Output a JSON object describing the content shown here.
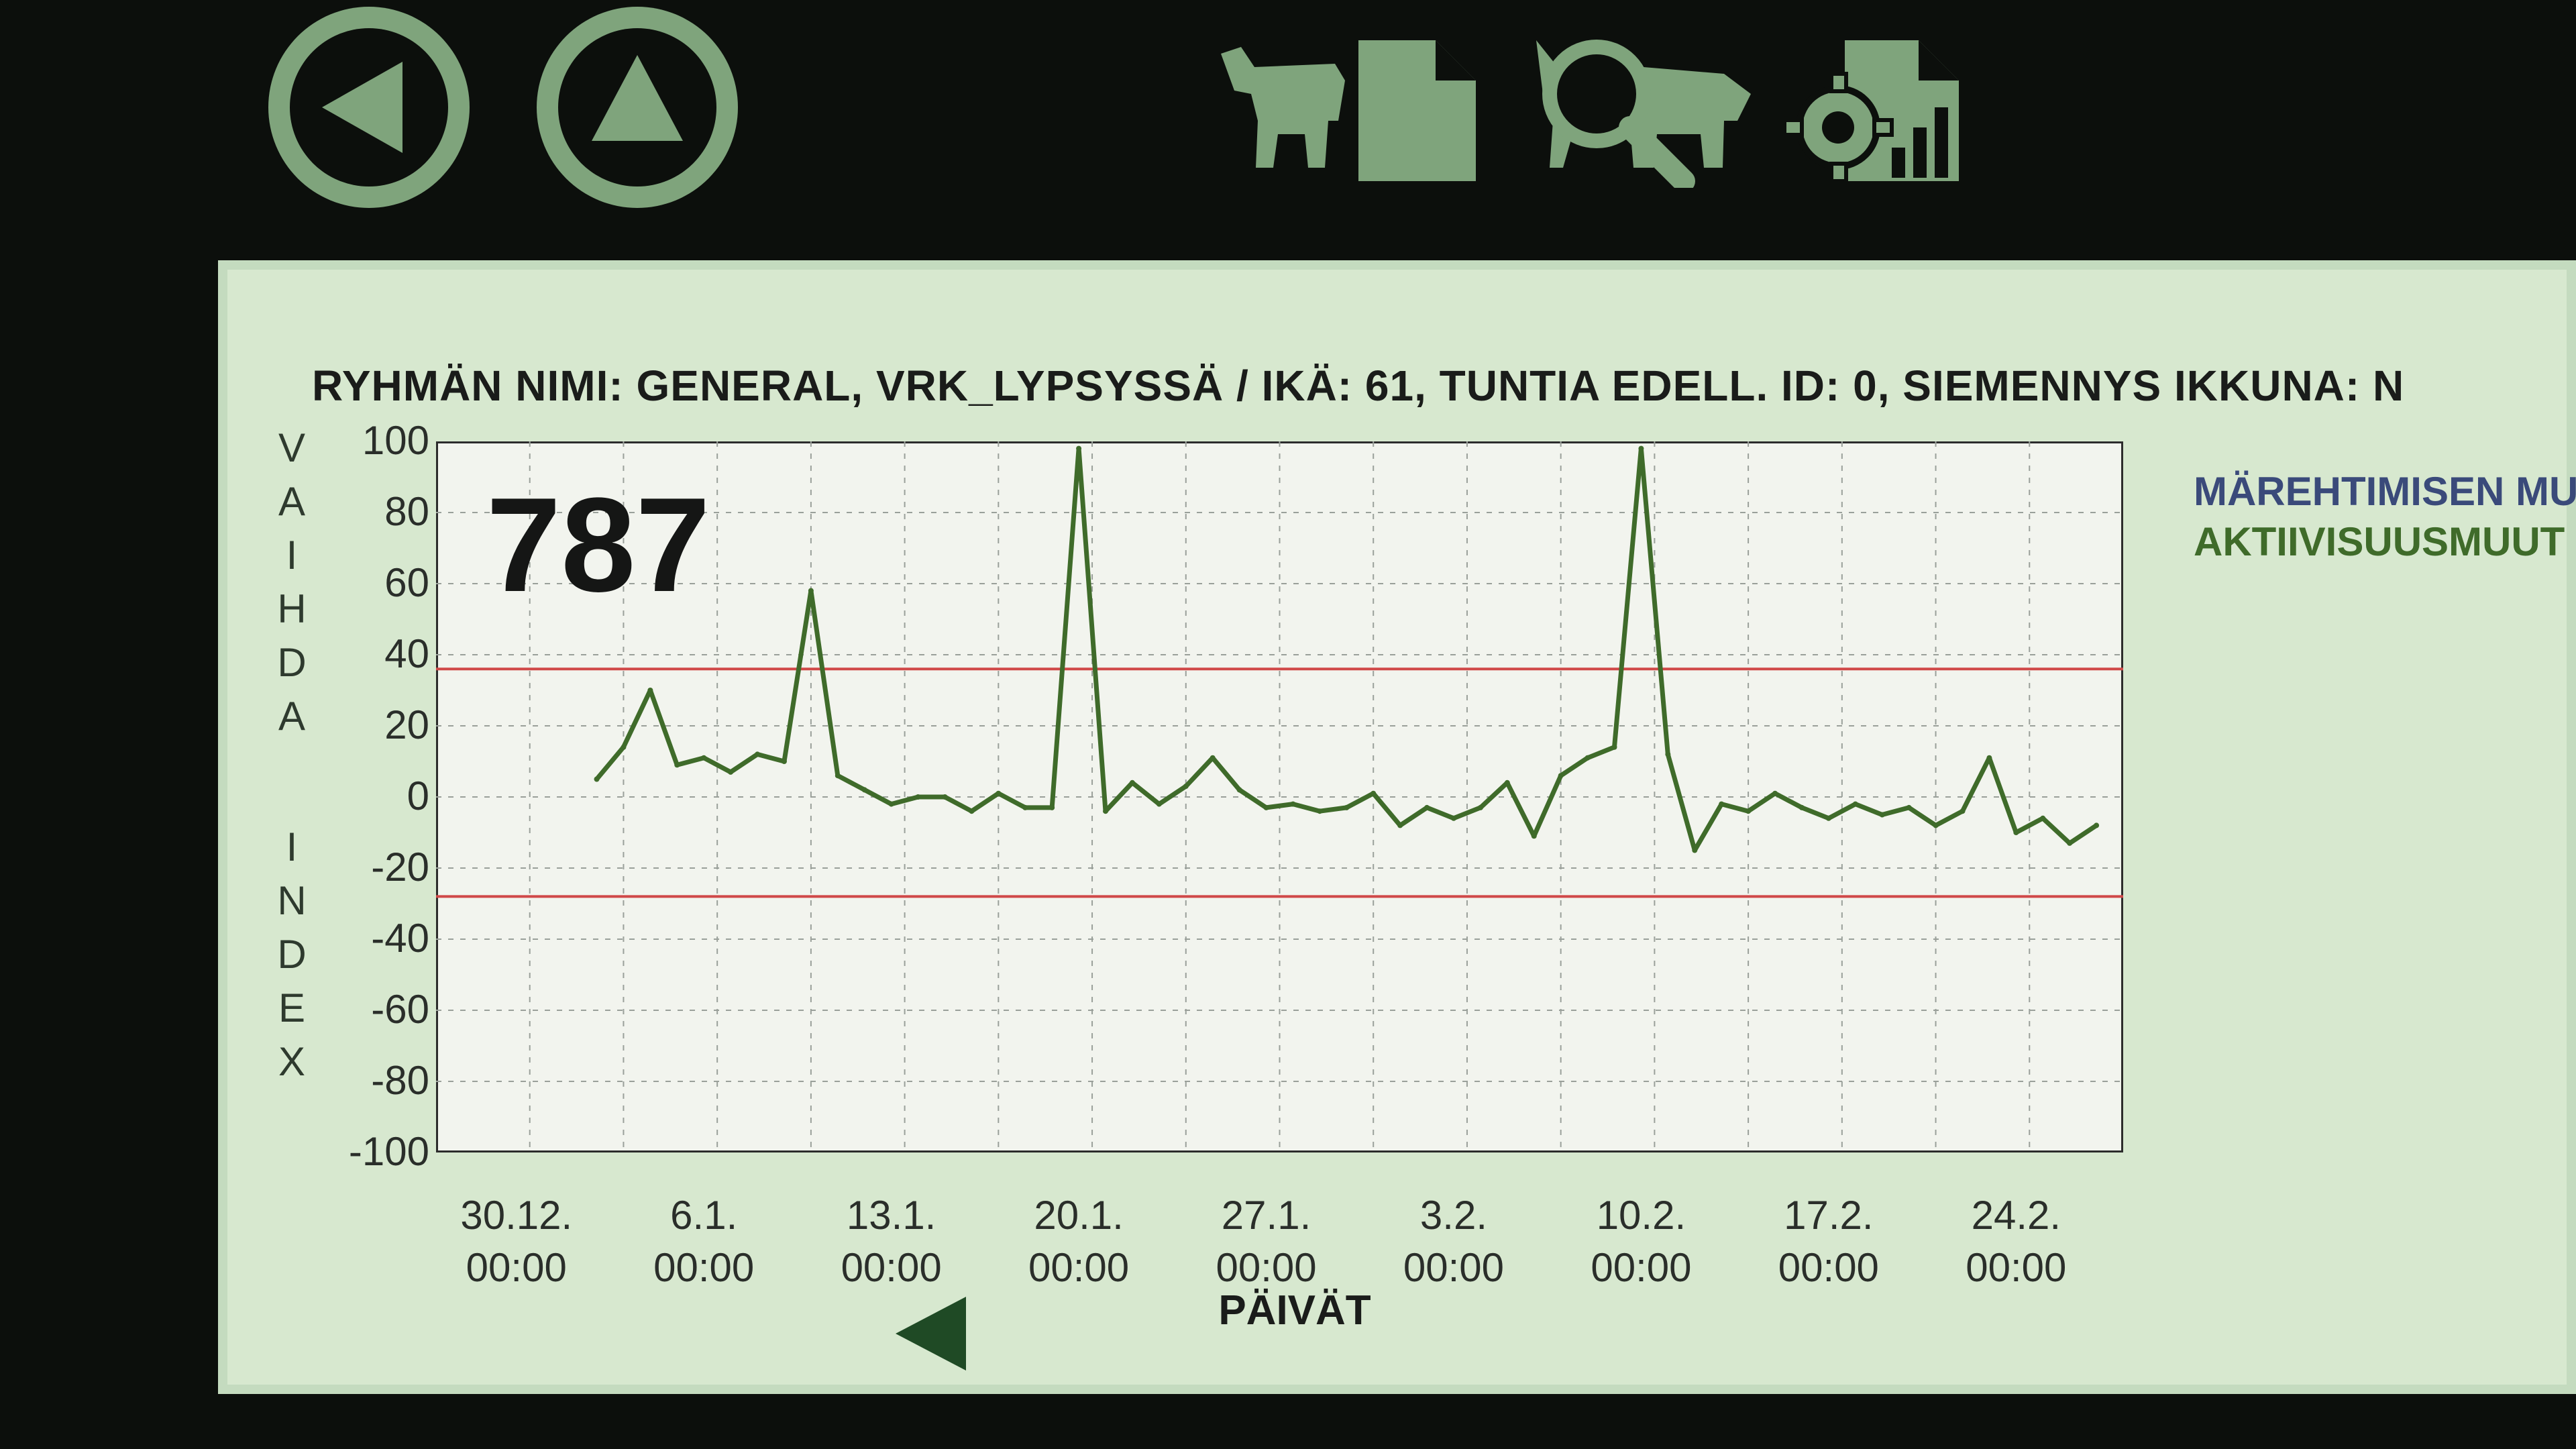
{
  "toolbar": {
    "icons": [
      "back-arrow-icon",
      "up-arrow-icon",
      "cow-report-icon",
      "search-cow-icon",
      "settings-chart-icon"
    ]
  },
  "header": {
    "text": "RYHMÄN NIMI: GENERAL, VRK_LYPSYSSÄ / IKÄ: 61, TUNTIA EDELL. ID: 0, SIEMENNYS IKKUNA: N"
  },
  "cow": {
    "id": "787"
  },
  "legend": {
    "items": [
      {
        "label": "MÄREHTIMISEN MU",
        "color": "#3a4a7a"
      },
      {
        "label": "AKTIIVISUUSMUUT",
        "color": "#3f6b2a"
      }
    ]
  },
  "nav": {
    "prev_symbol": "◀"
  },
  "chart_data": {
    "type": "line",
    "ylabel": "VAIHDA INDEX",
    "xlabel": "PÄIVÄT",
    "ylim": [
      -100,
      100
    ],
    "yticks": [
      "100",
      "80",
      "60",
      "40",
      "20",
      "0",
      "-20",
      "-40",
      "-60",
      "-80",
      "-100"
    ],
    "xticks": [
      {
        "date": "30.12.",
        "time": "00:00"
      },
      {
        "date": "6.1.",
        "time": "00:00"
      },
      {
        "date": "13.1.",
        "time": "00:00"
      },
      {
        "date": "20.1.",
        "time": "00:00"
      },
      {
        "date": "27.1.",
        "time": "00:00"
      },
      {
        "date": "3.2.",
        "time": "00:00"
      },
      {
        "date": "10.2.",
        "time": "00:00"
      },
      {
        "date": "17.2.",
        "time": "00:00"
      },
      {
        "date": "24.2.",
        "time": "00:00"
      }
    ],
    "thresholds": [
      {
        "value": 36,
        "color": "#d04848"
      },
      {
        "value": -28,
        "color": "#d04848"
      }
    ],
    "series": [
      {
        "color": "#3f6b2a",
        "x": [
          "2.1.",
          "3.1.",
          "4.1.",
          "5.1.",
          "6.1.",
          "7.1.",
          "8.1.",
          "9.1.",
          "10.1.",
          "11.1.",
          "12.1.",
          "13.1.",
          "14.1.",
          "15.1.",
          "16.1.",
          "17.1.",
          "18.1.",
          "19.1.",
          "20.1.",
          "21.1.",
          "22.1.",
          "23.1.",
          "24.1.",
          "25.1.",
          "26.1.",
          "27.1.",
          "28.1.",
          "29.1.",
          "30.1.",
          "31.1.",
          "1.2.",
          "2.2.",
          "3.2.",
          "4.2.",
          "5.2.",
          "6.2.",
          "7.2.",
          "8.2.",
          "9.2.",
          "10.2.",
          "11.2.",
          "12.2.",
          "13.2.",
          "14.2.",
          "15.2.",
          "16.2.",
          "17.2.",
          "18.2.",
          "19.2.",
          "20.2.",
          "21.2.",
          "22.2.",
          "23.2.",
          "24.2.",
          "25.2.",
          "26.2.",
          "27.2."
        ],
        "values": [
          5,
          14,
          30,
          9,
          11,
          7,
          12,
          10,
          58,
          6,
          2,
          -2,
          0,
          0,
          -4,
          1,
          -3,
          -3,
          98,
          -4,
          4,
          -2,
          3,
          11,
          2,
          -3,
          -2,
          -4,
          -3,
          1,
          -8,
          -3,
          -6,
          -3,
          4,
          -11,
          6,
          11,
          14,
          98,
          12,
          -15,
          -2,
          -4,
          1,
          -3,
          -6,
          -2,
          -5,
          -3,
          -8,
          -4,
          11,
          -10,
          -6,
          -13,
          -8
        ]
      }
    ]
  }
}
